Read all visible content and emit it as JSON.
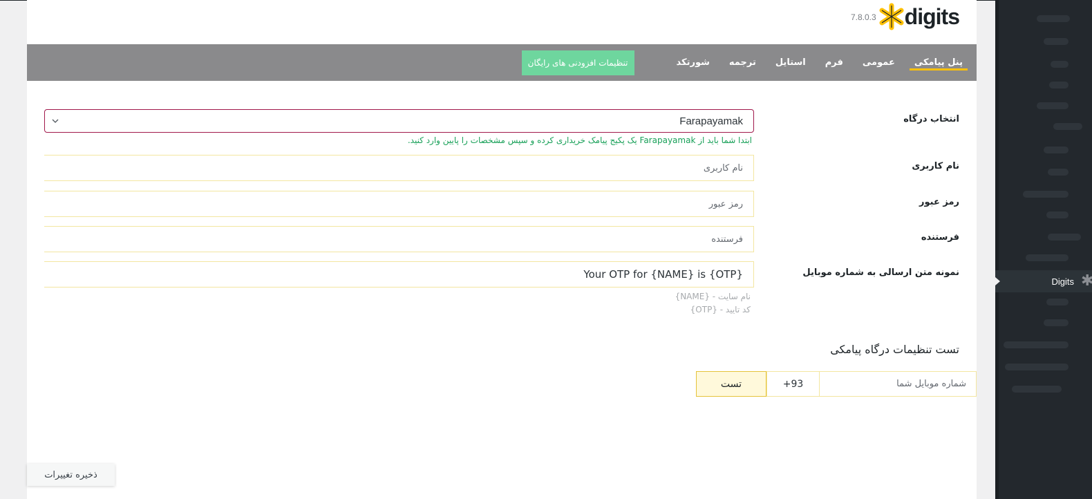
{
  "brand": {
    "version": "7.8.0.3",
    "name": "digits",
    "accent": "#ffc107"
  },
  "tabs": [
    {
      "label": "پنل پیامکی",
      "active": true
    },
    {
      "label": "عمومی",
      "active": false
    },
    {
      "label": "فرم",
      "active": false
    },
    {
      "label": "استایل",
      "active": false
    },
    {
      "label": "ترجمه",
      "active": false
    },
    {
      "label": "شورتکد",
      "active": false
    }
  ],
  "addon_button": {
    "label": "تنظیمات افزودنی های رایگان",
    "color": "#6ed69e"
  },
  "gateway": {
    "label": "انتخاب درگاه",
    "selected": "Farapayamak",
    "hint": "ابتدا شما باید از Farapayamak یک پکیج پیامک خریداری کرده و سپس مشخصات را پایین وارد کنید."
  },
  "fields": {
    "username": {
      "label": "نام کاربری",
      "placeholder": "نام کاربری"
    },
    "password": {
      "label": "رمز عبور",
      "placeholder": "رمز عبور"
    },
    "sender": {
      "label": "فرستنده",
      "placeholder": "فرستنده"
    },
    "template": {
      "label": "نمونه متن ارسالی به شماره موبایل",
      "value": "Your OTP for {NAME} is {OTP}"
    }
  },
  "template_tags": [
    "نام سایت - {NAME}",
    "کد تایید - {OTP}"
  ],
  "test_section": {
    "title": "تست تنظیمات درگاه پیامکی",
    "phone_placeholder": "شماره موبایل شما",
    "country_code": "+93",
    "test_button": "تست"
  },
  "save_button": "ذخیره تغییرات",
  "admin_menu": {
    "current_item": "Digits",
    "current_icon": "digits-asterisk-icon"
  }
}
